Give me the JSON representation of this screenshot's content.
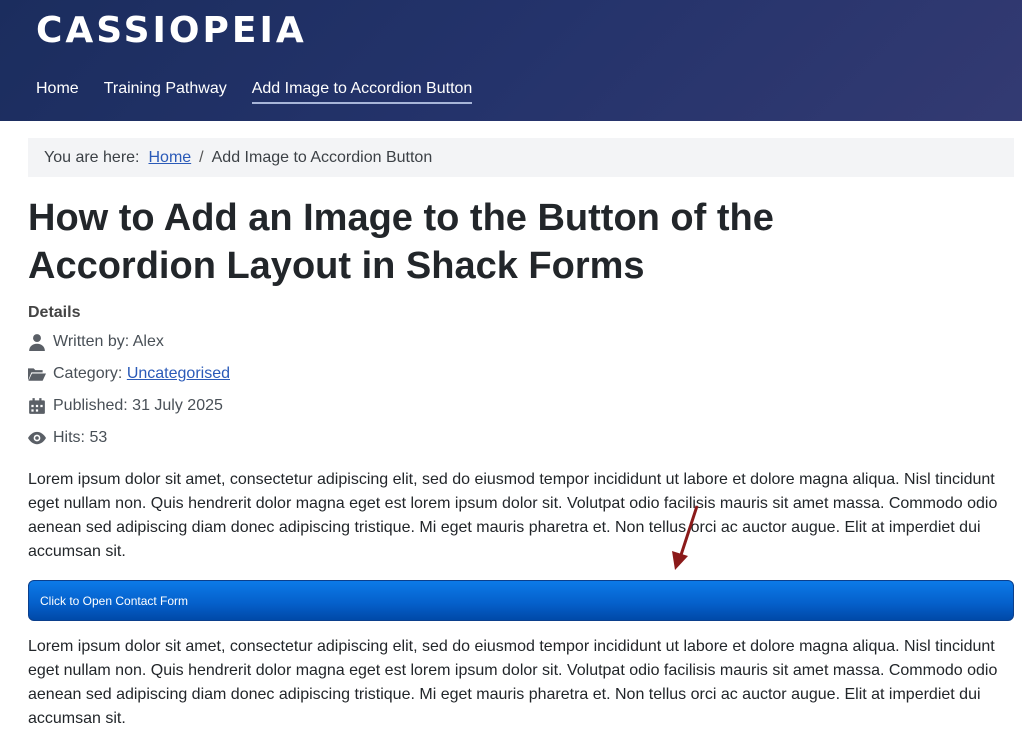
{
  "header": {
    "brand": "CASSIOPEIA",
    "nav": [
      {
        "label": "Home"
      },
      {
        "label": "Training Pathway"
      },
      {
        "label": "Add Image to Accordion Button"
      }
    ]
  },
  "breadcrumb": {
    "prefix": "You are here:",
    "home": "Home",
    "separator": "/",
    "current": "Add Image to Accordion Button"
  },
  "article": {
    "title": "How to Add an Image to the Button of the Accordion Layout in Shack Forms",
    "details_heading": "Details",
    "written_by": "Written by: Alex",
    "category_label": "Category:",
    "category_value": "Uncategorised",
    "published": "Published: 31 July 2025",
    "hits": "Hits: 53",
    "paragraph1": "Lorem ipsum dolor sit amet, consectetur adipiscing elit, sed do eiusmod tempor incididunt ut labore et dolore magna aliqua. Nisl tincidunt eget nullam non. Quis hendrerit dolor magna eget est lorem ipsum dolor sit. Volutpat odio facilisis mauris sit amet massa. Commodo odio aenean sed adipiscing diam donec adipiscing tristique. Mi eget mauris pharetra et. Non tellus orci ac auctor augue. Elit at imperdiet dui accumsan sit.",
    "accordion_label": "Click to Open Contact Form",
    "paragraph2": "Lorem ipsum dolor sit amet, consectetur adipiscing elit, sed do eiusmod tempor incididunt ut labore et dolore magna aliqua. Nisl tincidunt eget nullam non. Quis hendrerit dolor magna eget est lorem ipsum dolor sit. Volutpat odio facilisis mauris sit amet massa. Commodo odio aenean sed adipiscing diam donec adipiscing tristique. Mi eget mauris pharetra et. Non tellus orci ac auctor augue. Elit at imperdiet dui accumsan sit."
  },
  "colors": {
    "header_gradient_start": "#1b2d5e",
    "header_gradient_end": "#333a72",
    "link": "#2a5ab8",
    "accordion_button": "#0561cc",
    "annotation_arrow": "#8b1a1a"
  },
  "icons": {
    "written_by": "user-icon",
    "category": "folder-open-icon",
    "published": "calendar-icon",
    "hits": "eye-icon"
  }
}
